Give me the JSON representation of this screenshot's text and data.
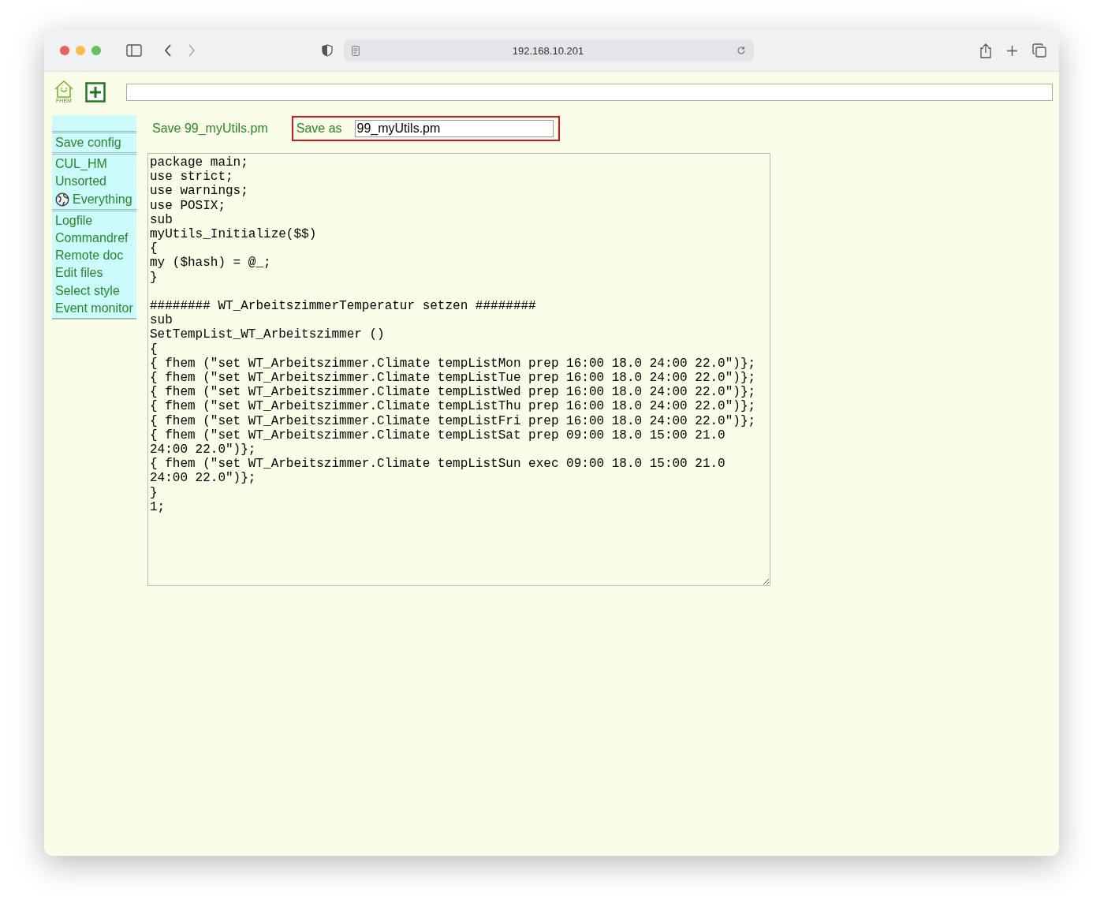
{
  "browser": {
    "url": "192.168.10.201"
  },
  "header": {
    "logo_text": "FHEM"
  },
  "sidebar": {
    "groups": [
      [
        {
          "label": "Save config",
          "kind": "plain"
        }
      ],
      [
        {
          "label": "CUL_HM",
          "kind": "plain"
        },
        {
          "label": "Unsorted",
          "kind": "plain"
        },
        {
          "label": "Everything",
          "kind": "globe"
        }
      ],
      [
        {
          "label": "Logfile",
          "kind": "plain"
        },
        {
          "label": "Commandref",
          "kind": "plain"
        },
        {
          "label": "Remote doc",
          "kind": "plain"
        },
        {
          "label": "Edit files",
          "kind": "plain"
        },
        {
          "label": "Select style",
          "kind": "plain"
        },
        {
          "label": "Event monitor",
          "kind": "plain"
        }
      ]
    ]
  },
  "editor": {
    "save_link": "Save 99_myUtils.pm",
    "save_as_label": "Save as",
    "save_as_value": "99_myUtils.pm",
    "code_blocks": [
      [
        "package main;",
        "use strict;",
        "use warnings;",
        "use POSIX;",
        "sub",
        "myUtils_Initialize($$)",
        "{",
        "my ($hash) = @_;",
        "}"
      ],
      [
        "######## WT_ArbeitszimmerTemperatur setzen ########",
        "sub",
        "SetTempList_WT_Arbeitszimmer ()",
        "{",
        "{ fhem (\"set WT_Arbeitszimmer.Climate tempListMon prep 16:00 18.0 24:00 22.0\")};",
        "{ fhem (\"set WT_Arbeitszimmer.Climate tempListTue prep 16:00 18.0 24:00 22.0\")};",
        "{ fhem (\"set WT_Arbeitszimmer.Climate tempListWed prep 16:00 18.0 24:00 22.0\")};",
        "{ fhem (\"set WT_Arbeitszimmer.Climate tempListThu prep 16:00 18.0 24:00 22.0\")};",
        "{ fhem (\"set WT_Arbeitszimmer.Climate tempListFri prep 16:00 18.0 24:00 22.0\")};",
        "{ fhem (\"set WT_Arbeitszimmer.Climate tempListSat prep 09:00 18.0 15:00 21.0 24:00 22.0\")};",
        "{ fhem (\"set WT_Arbeitszimmer.Climate tempListSun exec 09:00 18.0 15:00 21.0 24:00 22.0\")};",
        "}",
        "1;"
      ]
    ]
  }
}
